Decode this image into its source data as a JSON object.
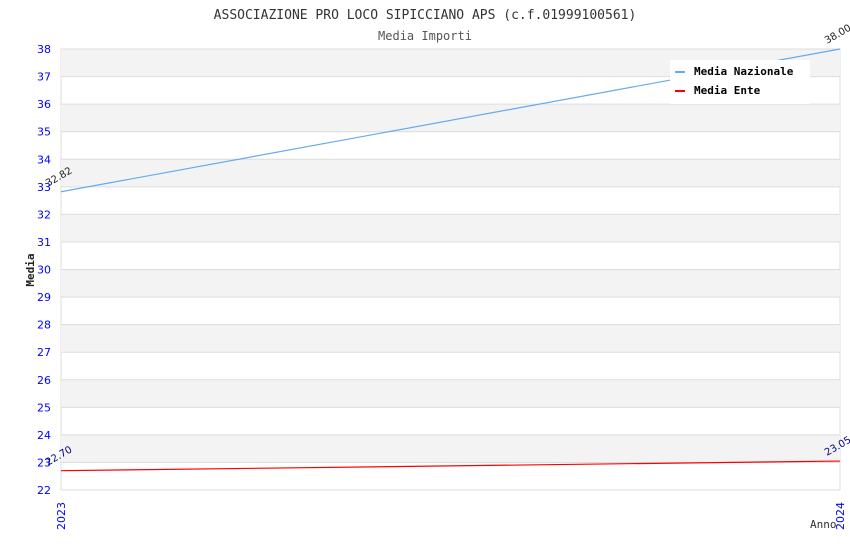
{
  "chart_data": {
    "type": "line",
    "title": "ASSOCIAZIONE PRO LOCO SIPICCIANO APS (c.f.01999100561)",
    "subtitle": "Media Importi",
    "xlabel": "Anno",
    "ylabel": "Media",
    "x": [
      "2023",
      "2024"
    ],
    "ylim": [
      22,
      38
    ],
    "yticks": [
      "22",
      "23",
      "24",
      "25",
      "26",
      "27",
      "28",
      "29",
      "30",
      "31",
      "32",
      "33",
      "34",
      "35",
      "36",
      "37",
      "38"
    ],
    "grid": true,
    "legend_position": "top-right",
    "series": [
      {
        "name": "Media Nazionale",
        "values": [
          32.82,
          38.0
        ],
        "labels": [
          "32.82",
          "38.00"
        ],
        "color": "#66aaee"
      },
      {
        "name": "Media Ente",
        "values": [
          22.7,
          23.05
        ],
        "labels": [
          "22.70",
          "23.05"
        ],
        "color": "#ff0000"
      }
    ],
    "colors": {
      "tick": "#0000ff",
      "band": "#f3f3f3",
      "grid": "#dddddd"
    }
  }
}
